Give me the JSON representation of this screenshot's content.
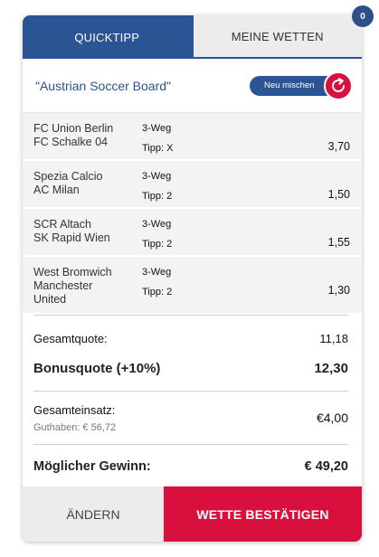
{
  "badge": {
    "count": "0"
  },
  "tabs": [
    {
      "label": "QUICKTIPP",
      "active": true
    },
    {
      "label": "MEINE WETTEN",
      "active": false
    }
  ],
  "board": {
    "name": "\"Austrian Soccer Board\"",
    "shuffle_label": "Neu mischen",
    "shuffle_icon": "refresh-icon"
  },
  "tips": [
    {
      "team1": "FC Union Berlin",
      "team2": "FC Schalke 04",
      "team3": "",
      "market": "3-Weg",
      "tip": "Tipp: X",
      "odd": "3,70"
    },
    {
      "team1": "Spezia Calcio",
      "team2": "AC Milan",
      "team3": "",
      "market": "3-Weg",
      "tip": "Tipp: 2",
      "odd": "1,50"
    },
    {
      "team1": "SCR Altach",
      "team2": "SK Rapid Wien",
      "team3": "",
      "market": "3-Weg",
      "tip": "Tipp: 2",
      "odd": "1,55"
    },
    {
      "team1": "West Bromwich",
      "team2": "Manchester",
      "team3": "United",
      "market": "3-Weg",
      "tip": "Tipp: 2",
      "odd": "1,30"
    }
  ],
  "summary": {
    "total_odds_label": "Gesamtquote:",
    "total_odds_value": "11,18",
    "bonus_label": "Bonusquote (+10%)",
    "bonus_value": "12,30",
    "stake_label": "Gesamteinsatz:",
    "credit_label": "Guthaben: € 56,72",
    "stake_value": "€4,00",
    "win_label": "Möglicher Gewinn:",
    "win_value": "€ 49,20"
  },
  "footer": {
    "change_label": "ÄNDERN",
    "confirm_label": "WETTE BESTÄTIGEN"
  },
  "colors": {
    "brand_blue": "#2b5494",
    "accent_red": "#d9103e"
  }
}
